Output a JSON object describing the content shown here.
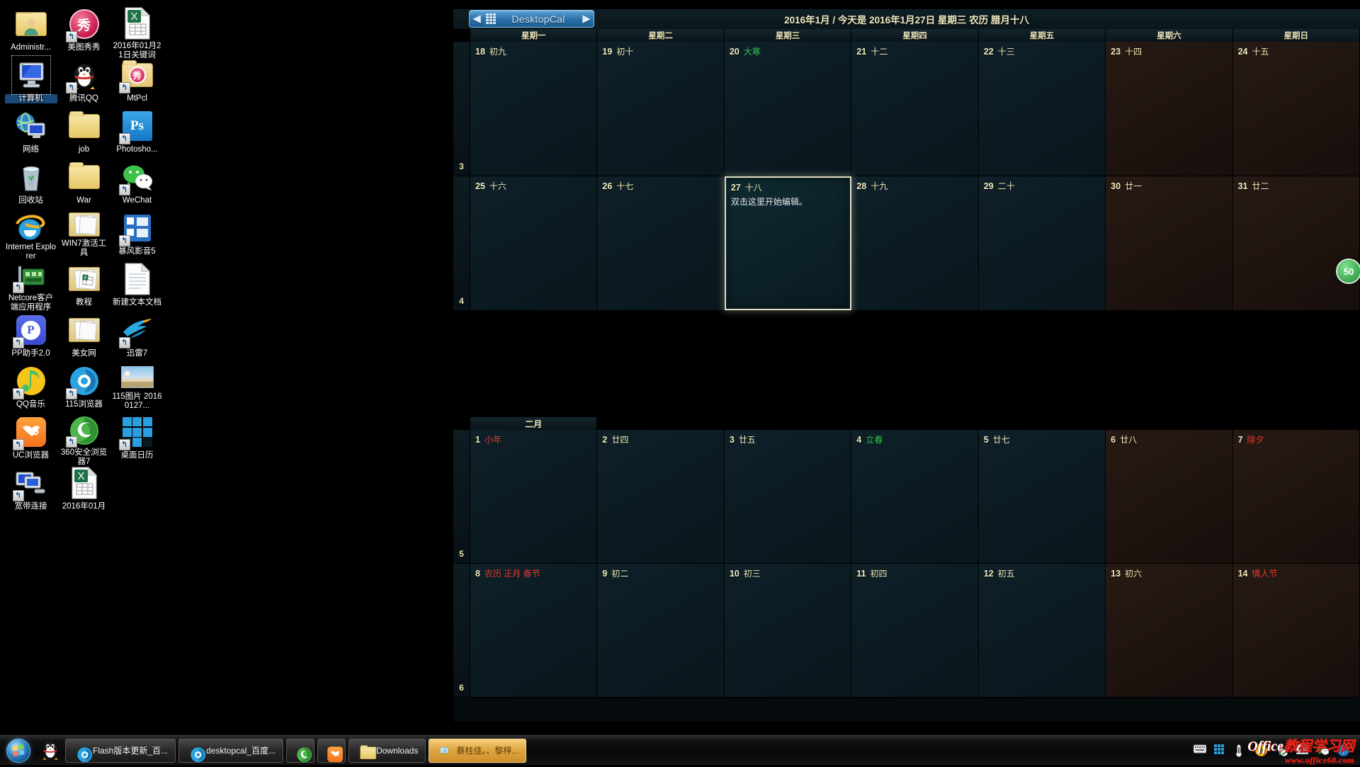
{
  "desktop": {
    "icons": [
      {
        "label": "Administr...",
        "icon": "user-folder-icon",
        "shortcut": false,
        "selected": false
      },
      {
        "label": "美图秀秀",
        "icon": "meitu-xiuxiu-icon",
        "shortcut": true,
        "selected": false
      },
      {
        "label": "2016年01月21日关键词",
        "icon": "excel-file-icon",
        "shortcut": false,
        "selected": false
      },
      {
        "label": "计算机",
        "icon": "computer-icon",
        "shortcut": false,
        "selected": true
      },
      {
        "label": "腾讯QQ",
        "icon": "qq-penguin-icon",
        "shortcut": true,
        "selected": false
      },
      {
        "label": "MtPcl",
        "icon": "meitu-folder-icon",
        "shortcut": true,
        "selected": false
      },
      {
        "label": "网络",
        "icon": "network-icon",
        "shortcut": false,
        "selected": false
      },
      {
        "label": "job",
        "icon": "folder-icon",
        "shortcut": false,
        "selected": false
      },
      {
        "label": "Photosho...",
        "icon": "photoshop-icon",
        "shortcut": true,
        "selected": false
      },
      {
        "label": "回收站",
        "icon": "recycle-bin-icon",
        "shortcut": false,
        "selected": false
      },
      {
        "label": "War",
        "icon": "folder-icon",
        "shortcut": false,
        "selected": false
      },
      {
        "label": "WeChat",
        "icon": "wechat-icon",
        "shortcut": true,
        "selected": false
      },
      {
        "label": "Internet Explorer",
        "icon": "internet-explorer-icon",
        "shortcut": false,
        "selected": false
      },
      {
        "label": "WIN7激活工具",
        "icon": "folder-open-icon",
        "shortcut": false,
        "selected": false
      },
      {
        "label": "暴风影音5",
        "icon": "baofeng-player-icon",
        "shortcut": true,
        "selected": false
      },
      {
        "label": "Netcore客户端应用程序",
        "icon": "netcore-icon",
        "shortcut": true,
        "selected": false
      },
      {
        "label": "教程",
        "icon": "folder-excel-icon",
        "shortcut": false,
        "selected": false
      },
      {
        "label": "新建文本文档",
        "icon": "text-document-icon",
        "shortcut": false,
        "selected": false
      },
      {
        "label": "PP助手2.0",
        "icon": "pp-assistant-icon",
        "shortcut": true,
        "selected": false
      },
      {
        "label": "美女网",
        "icon": "folder-open-icon",
        "shortcut": false,
        "selected": false
      },
      {
        "label": "迅雷7",
        "icon": "thunder-xunlei-icon",
        "shortcut": true,
        "selected": false
      },
      {
        "label": "QQ音乐",
        "icon": "qq-music-icon",
        "shortcut": true,
        "selected": false
      },
      {
        "label": "115浏览器",
        "icon": "browser-115-icon",
        "shortcut": true,
        "selected": false
      },
      {
        "label": "115图片 20160127...",
        "icon": "image-thumbnail-icon",
        "shortcut": false,
        "selected": false
      },
      {
        "label": "UC浏览器",
        "icon": "uc-browser-icon",
        "shortcut": true,
        "selected": false
      },
      {
        "label": "360安全浏览器7",
        "icon": "browser-360-icon",
        "shortcut": true,
        "selected": false
      },
      {
        "label": "桌面日历",
        "icon": "desktop-calendar-icon",
        "shortcut": true,
        "selected": false
      },
      {
        "label": "宽带连接",
        "icon": "broadband-connection-icon",
        "shortcut": true,
        "selected": false
      },
      {
        "label": "2016年01月",
        "icon": "excel-file-icon",
        "shortcut": false,
        "selected": false
      }
    ]
  },
  "calendar": {
    "app_title": "DesktopCal",
    "prev_arrow": "◀",
    "next_arrow": "▶",
    "header_date": "2016年1月 / 今天是 2016年1月27日 星期三 农历 腊月十八",
    "weekdays": [
      "星期一",
      "星期二",
      "星期三",
      "星期四",
      "星期五",
      "星期六",
      "星期日"
    ],
    "month_divider_label": "二月",
    "side_badge": "50",
    "weeks": [
      {
        "weekno": "3",
        "days": [
          {
            "num": "18",
            "lunar": "初九",
            "lunar_color": "normal",
            "weekend": false,
            "note": "",
            "selected": false
          },
          {
            "num": "19",
            "lunar": "初十",
            "lunar_color": "normal",
            "weekend": false,
            "note": "",
            "selected": false
          },
          {
            "num": "20",
            "lunar": "大寒",
            "lunar_color": "green",
            "weekend": false,
            "note": "",
            "selected": false
          },
          {
            "num": "21",
            "lunar": "十二",
            "lunar_color": "normal",
            "weekend": false,
            "note": "",
            "selected": false
          },
          {
            "num": "22",
            "lunar": "十三",
            "lunar_color": "normal",
            "weekend": false,
            "note": "",
            "selected": false
          },
          {
            "num": "23",
            "lunar": "十四",
            "lunar_color": "normal",
            "weekend": true,
            "note": "",
            "selected": false
          },
          {
            "num": "24",
            "lunar": "十五",
            "lunar_color": "normal",
            "weekend": true,
            "note": "",
            "selected": false
          }
        ]
      },
      {
        "weekno": "4",
        "days": [
          {
            "num": "25",
            "lunar": "十六",
            "lunar_color": "normal",
            "weekend": false,
            "note": "",
            "selected": false
          },
          {
            "num": "26",
            "lunar": "十七",
            "lunar_color": "normal",
            "weekend": false,
            "note": "",
            "selected": false
          },
          {
            "num": "27",
            "lunar": "十八",
            "lunar_color": "normal",
            "weekend": false,
            "note": "双击这里开始编辑。",
            "selected": true
          },
          {
            "num": "28",
            "lunar": "十九",
            "lunar_color": "normal",
            "weekend": false,
            "note": "",
            "selected": false
          },
          {
            "num": "29",
            "lunar": "二十",
            "lunar_color": "normal",
            "weekend": false,
            "note": "",
            "selected": false
          },
          {
            "num": "30",
            "lunar": "廿一",
            "lunar_color": "normal",
            "weekend": true,
            "note": "",
            "selected": false
          },
          {
            "num": "31",
            "lunar": "廿二",
            "lunar_color": "normal",
            "weekend": true,
            "note": "",
            "selected": false
          }
        ]
      },
      {
        "weekno": "5",
        "days": [
          {
            "num": "1",
            "lunar": "小年",
            "lunar_color": "red",
            "weekend": false,
            "note": "",
            "selected": false
          },
          {
            "num": "2",
            "lunar": "廿四",
            "lunar_color": "normal",
            "weekend": false,
            "note": "",
            "selected": false
          },
          {
            "num": "3",
            "lunar": "廿五",
            "lunar_color": "normal",
            "weekend": false,
            "note": "",
            "selected": false
          },
          {
            "num": "4",
            "lunar": "立春",
            "lunar_color": "green",
            "weekend": false,
            "note": "",
            "selected": false
          },
          {
            "num": "5",
            "lunar": "廿七",
            "lunar_color": "normal",
            "weekend": false,
            "note": "",
            "selected": false
          },
          {
            "num": "6",
            "lunar": "廿八",
            "lunar_color": "normal",
            "weekend": true,
            "note": "",
            "selected": false
          },
          {
            "num": "7",
            "lunar": "除夕",
            "lunar_color": "red",
            "weekend": true,
            "note": "",
            "selected": false
          }
        ]
      },
      {
        "weekno": "6",
        "days": [
          {
            "num": "8",
            "lunar": "农历 正月 春节",
            "lunar_color": "red",
            "weekend": false,
            "note": "",
            "selected": false
          },
          {
            "num": "9",
            "lunar": "初二",
            "lunar_color": "normal",
            "weekend": false,
            "note": "",
            "selected": false
          },
          {
            "num": "10",
            "lunar": "初三",
            "lunar_color": "normal",
            "weekend": false,
            "note": "",
            "selected": false
          },
          {
            "num": "11",
            "lunar": "初四",
            "lunar_color": "normal",
            "weekend": false,
            "note": "",
            "selected": false
          },
          {
            "num": "12",
            "lunar": "初五",
            "lunar_color": "normal",
            "weekend": false,
            "note": "",
            "selected": false
          },
          {
            "num": "13",
            "lunar": "初六",
            "lunar_color": "normal",
            "weekend": true,
            "note": "",
            "selected": false
          },
          {
            "num": "14",
            "lunar": "情人节",
            "lunar_color": "red",
            "weekend": true,
            "note": "",
            "selected": false
          }
        ]
      }
    ]
  },
  "taskbar": {
    "start_label": "开始",
    "quicklaunch": [
      {
        "name": "qq-penguin-icon"
      }
    ],
    "tasks": [
      {
        "label": "Flash版本更新_百...",
        "icon": "browser-115-icon",
        "active": false
      },
      {
        "label": "desktopcal_百度...",
        "icon": "browser-115-icon",
        "active": false
      },
      {
        "label": "",
        "icon": "browser-360-icon",
        "active": false
      },
      {
        "label": "",
        "icon": "uc-browser-icon",
        "active": false
      },
      {
        "label": "Downloads",
        "icon": "folder-icon",
        "active": false
      },
      {
        "label": "蔡柱佳。、黎梓...",
        "icon": "chat-message-icon",
        "active": true
      }
    ],
    "tray": [
      {
        "name": "keyboard-ime-icon"
      },
      {
        "name": "language-bar-icon"
      },
      {
        "name": "thermometer-icon"
      },
      {
        "name": "security-shield-icon"
      },
      {
        "name": "usb-safe-remove-icon"
      },
      {
        "name": "picture-tray-icon"
      },
      {
        "name": "wechat-tray-icon"
      },
      {
        "name": "help-tray-icon"
      }
    ]
  },
  "watermark": {
    "line1_office": "Office",
    "line1_rest": "教程学习网",
    "line2": "www.office68.com"
  },
  "colors": {
    "accent_blue": "#2a6fa8",
    "cal_text": "#f3ecc0",
    "holiday_red": "#e63a2e",
    "solar_term_green": "#35c24a",
    "weekend_bg": "#271a14"
  }
}
